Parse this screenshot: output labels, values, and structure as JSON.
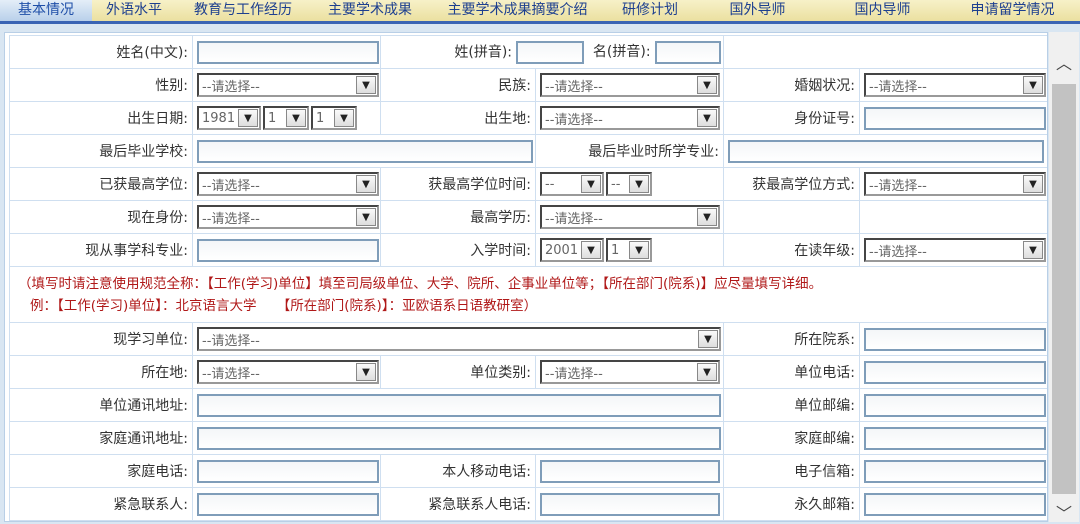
{
  "tabs": [
    "基本情况",
    "外语水平",
    "教育与工作经历",
    "主要学术成果",
    "主要学术成果摘要介绍",
    "研修计划",
    "国外导师",
    "国内导师",
    "申请留学情况"
  ],
  "active_tab": 0,
  "placeholder": "--请选择--",
  "labels": {
    "name_cn": "姓名(中文):",
    "surname_py": "姓(拼音):",
    "given_py": "名(拼音):",
    "gender": "性别:",
    "ethnicity": "民族:",
    "marital": "婚姻状况:",
    "birth_date": "出生日期:",
    "birthplace": "出生地:",
    "id_no": "身份证号:",
    "last_school": "最后毕业学校:",
    "last_major": "最后毕业时所学专业:",
    "degree": "已获最高学位:",
    "degree_time": "获最高学位时间:",
    "degree_way": "获最高学位方式:",
    "status": "现在身份:",
    "education": "最高学历:",
    "subject": "现从事学科专业:",
    "enroll_time": "入学时间:",
    "grade": "在读年级:",
    "unit": "现学习单位:",
    "dept": "所在院系:",
    "location": "所在地:",
    "unit_type": "单位类别:",
    "unit_phone": "单位电话:",
    "unit_addr": "单位通讯地址:",
    "unit_zip": "单位邮编:",
    "home_addr": "家庭通讯地址:",
    "home_zip": "家庭邮编:",
    "home_phone": "家庭电话:",
    "mobile": "本人移动电话:",
    "email": "电子信箱:",
    "emergency": "紧急联系人:",
    "emergency_phone": "紧急联系人电话:",
    "perm_email": "永久邮箱:"
  },
  "values": {
    "birth_year": "1981",
    "birth_month": "1",
    "birth_day": "1",
    "degree_year": "--",
    "degree_month": "--",
    "enroll_year": "2001",
    "enroll_month": "1"
  },
  "note": {
    "line1": "（填写时请注意使用规范全称：【工作(学习)单位】填至司局级单位、大学、院所、企事业单位等；【所在部门(院系)】应尽量填写详细。",
    "line2": "例：【工作(学习)单位】：北京语言大学　　【所在部门(院系)】：亚欧语系日语教研室）"
  }
}
